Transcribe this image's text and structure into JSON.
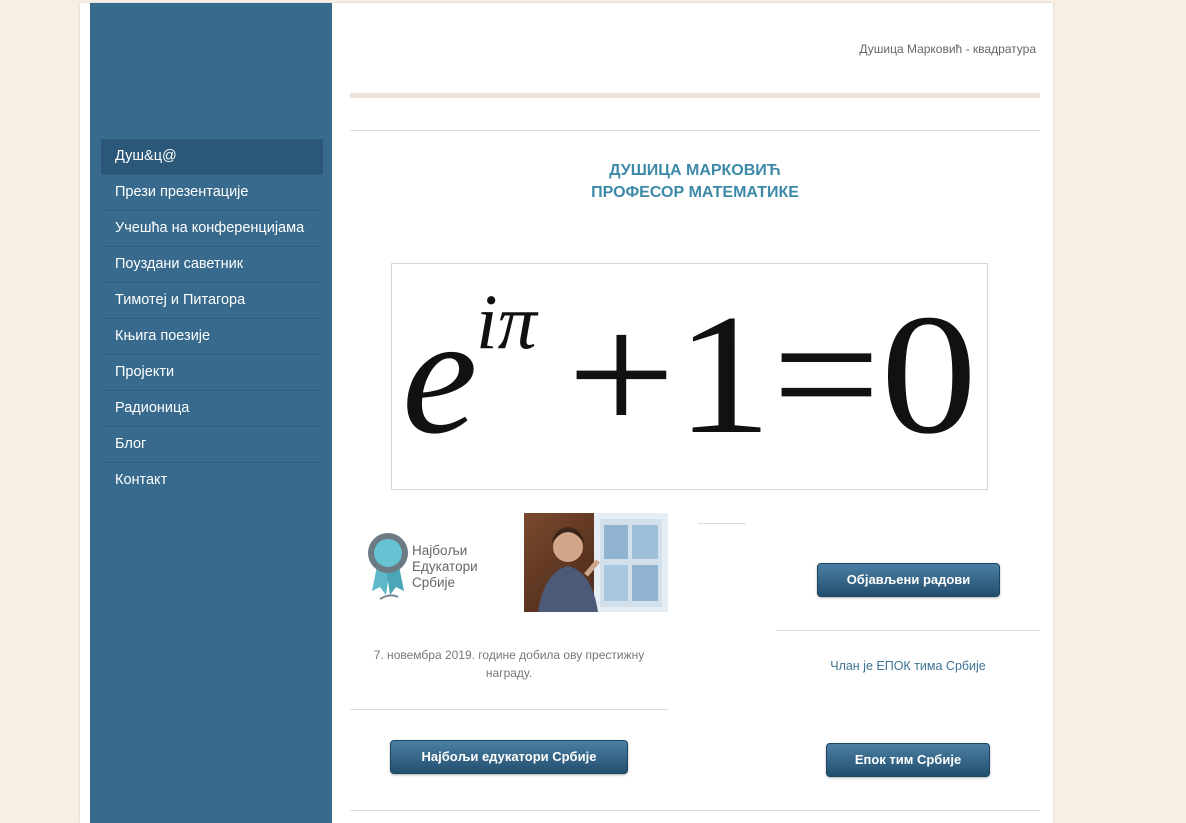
{
  "header": {
    "tagline": "Душица Марковић - квадратура"
  },
  "sidebar": {
    "items": [
      {
        "label": "Душ&ц@",
        "active": true
      },
      {
        "label": "Прези презентације"
      },
      {
        "label": "Учешћа на конференцијама"
      },
      {
        "label": "Поуздани саветник"
      },
      {
        "label": "Тимотеј и Питагора"
      },
      {
        "label": "Књига поезије"
      },
      {
        "label": "Пројекти"
      },
      {
        "label": "Радионица"
      },
      {
        "label": "Блог"
      },
      {
        "label": "Контакт"
      }
    ]
  },
  "main": {
    "title_line1": "ДУШИЦА МАРКОВИЋ",
    "title_line2": "ПРОФЕСОР МАТЕМАТИКЕ",
    "formula": {
      "base": "e",
      "exponent": "iπ",
      "rest": "+1=0"
    },
    "badge": {
      "line1": "Најбољи",
      "line2": "Едукатори",
      "line3": "Србије"
    },
    "award_caption": "7. новембра 2019. године добила ову престижну награду.",
    "button_best_educators": "Најбољи едукатори Србије",
    "button_published": "Објављени радови",
    "epok_link": "Члан је ЕПОК тима Србије",
    "button_epok": "Епок тим Србије"
  },
  "colors": {
    "sidebar": "#376a8c",
    "accent_heading": "#3d8aa8",
    "page_background": "#f7eee5",
    "button": "#2e5b7d"
  }
}
